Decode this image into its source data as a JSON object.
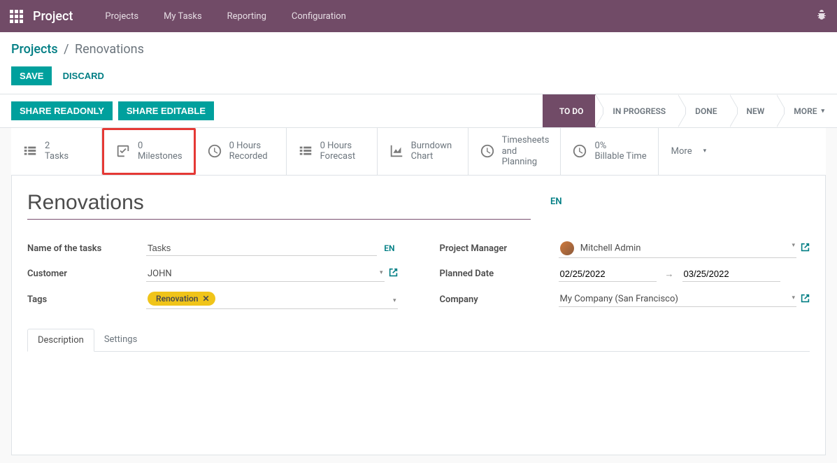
{
  "navbar": {
    "brand": "Project",
    "links": [
      "Projects",
      "My Tasks",
      "Reporting",
      "Configuration"
    ]
  },
  "breadcrumb": {
    "root": "Projects",
    "current": "Renovations"
  },
  "actions": {
    "save": "SAVE",
    "discard": "DISCARD"
  },
  "share": {
    "readonly": "SHARE READONLY",
    "editable": "SHARE EDITABLE"
  },
  "statusbar": {
    "todo": "TO DO",
    "in_progress": "IN PROGRESS",
    "done": "DONE",
    "new": "NEW",
    "more": "MORE"
  },
  "stats": {
    "tasks": {
      "value": "2",
      "label": "Tasks"
    },
    "milestones": {
      "value": "0",
      "label": "Milestones"
    },
    "recorded": {
      "value": "0 Hours",
      "label": "Recorded"
    },
    "forecast": {
      "value": "0 Hours",
      "label": "Forecast"
    },
    "burndown": {
      "value": "Burndown",
      "label": "Chart"
    },
    "timesheets": {
      "value": "Timesheets",
      "label1": "and",
      "label2": "Planning"
    },
    "billable": {
      "value": "0%",
      "label": "Billable Time"
    },
    "more": "More"
  },
  "title": {
    "value": "Renovations",
    "lang": "EN"
  },
  "fields": {
    "name_of_tasks_label": "Name of the tasks",
    "name_of_tasks_value": "Tasks",
    "name_of_tasks_lang": "EN",
    "customer_label": "Customer",
    "customer_value": "JOHN",
    "tags_label": "Tags",
    "tag_value": "Renovation",
    "pm_label": "Project Manager",
    "pm_value": "Mitchell Admin",
    "planned_label": "Planned Date",
    "planned_start": "02/25/2022",
    "planned_end": "03/25/2022",
    "company_label": "Company",
    "company_value": "My Company (San Francisco)"
  },
  "tabs": {
    "description": "Description",
    "settings": "Settings"
  }
}
